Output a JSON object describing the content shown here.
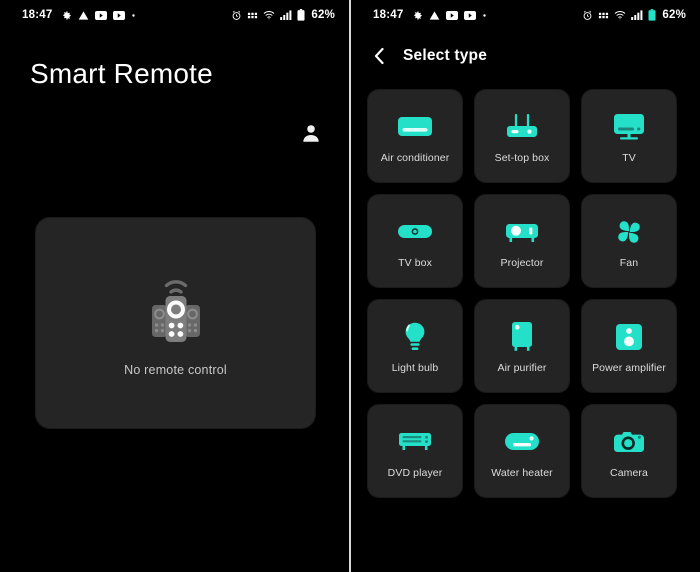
{
  "accent": "#25E0C8",
  "card_bg": "#242424",
  "page_bg": "#000000",
  "left_screen": {
    "status_bar": {
      "clock": "18:47",
      "left_icons": [
        "gear-icon",
        "warning-triangle-icon",
        "youtube-icon",
        "youtube-icon",
        "dot-icon"
      ],
      "right_icons": [
        "alarm-clock-icon",
        "vpn-icon",
        "wifi-icon",
        "signal-bars-icon",
        "battery-icon"
      ],
      "battery_percent": "62%"
    },
    "app_title": "Smart Remote",
    "account_icon": "person-icon",
    "empty_state": {
      "illustration": "three-remotes-signal-icon",
      "message": "No remote control"
    }
  },
  "right_screen": {
    "status_bar": {
      "clock": "18:47",
      "left_icons": [
        "gear-icon",
        "warning-triangle-icon",
        "youtube-icon",
        "youtube-icon",
        "dot-icon"
      ],
      "right_icons": [
        "alarm-clock-icon",
        "vpn-icon",
        "wifi-icon",
        "signal-bars-icon",
        "battery-icon"
      ],
      "battery_percent": "62%"
    },
    "topbar": {
      "back_icon": "chevron-left-icon",
      "title": "Select type"
    },
    "device_types": [
      {
        "label": "Air conditioner",
        "icon": "air-conditioner-icon"
      },
      {
        "label": "Set-top box",
        "icon": "set-top-box-icon"
      },
      {
        "label": "TV",
        "icon": "tv-icon"
      },
      {
        "label": "TV box",
        "icon": "tv-box-icon"
      },
      {
        "label": "Projector",
        "icon": "projector-icon"
      },
      {
        "label": "Fan",
        "icon": "fan-icon"
      },
      {
        "label": "Light bulb",
        "icon": "light-bulb-icon"
      },
      {
        "label": "Air purifier",
        "icon": "air-purifier-icon"
      },
      {
        "label": "Power amplifier",
        "icon": "power-amplifier-icon"
      },
      {
        "label": "DVD player",
        "icon": "dvd-player-icon"
      },
      {
        "label": "Water heater",
        "icon": "water-heater-icon"
      },
      {
        "label": "Camera",
        "icon": "camera-icon"
      }
    ]
  }
}
